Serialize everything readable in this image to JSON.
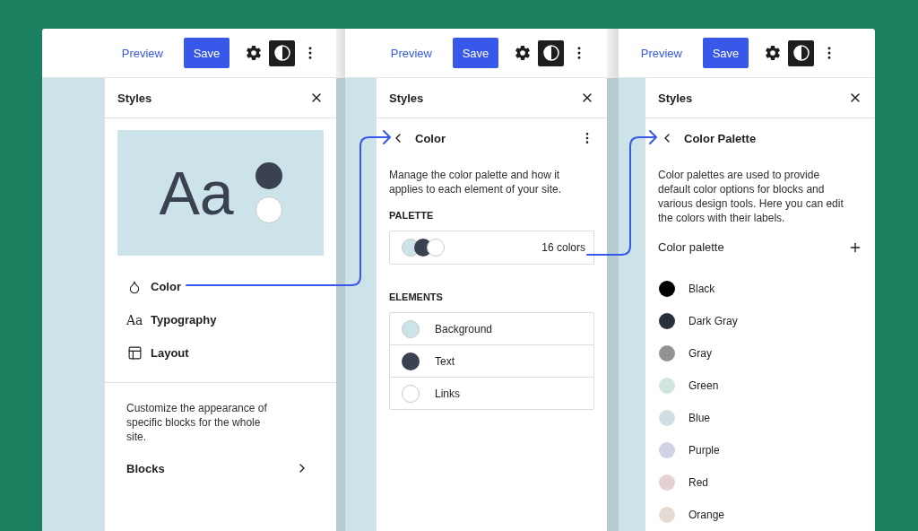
{
  "screens": [
    {
      "kind": "styles",
      "preview_link": "Preview",
      "save_button": "Save",
      "panel_title": "Styles",
      "style_preview": {
        "sample": "Aa",
        "swatches": [
          {
            "color": "#3a4252"
          },
          {
            "color": "#ffffff"
          }
        ]
      },
      "menu": [
        {
          "kind": "droplet",
          "label": "Color"
        },
        {
          "kind": "glyph",
          "glyph": "Aa",
          "label": "Typography"
        },
        {
          "kind": "layout",
          "label": "Layout"
        }
      ],
      "description": "Customize the appearance of specific blocks for the whole site.",
      "blocks_label": "Blocks"
    },
    {
      "kind": "color",
      "preview_link": "Preview",
      "save_button": "Save",
      "panel_title": "Styles",
      "back_title": "Color",
      "description": "Manage the color palette and how it applies to each element of your site.",
      "palette_heading": "PALETTE",
      "palette_swatches": [
        {
          "color": "#cde3ea"
        },
        {
          "color": "#3a4252"
        },
        {
          "color": "#ffffff"
        }
      ],
      "palette_count": "16 colors",
      "elements_heading": "ELEMENTS",
      "elements": [
        {
          "label": "Background",
          "color": "#cde3ea"
        },
        {
          "label": "Text",
          "color": "#3a4252"
        },
        {
          "label": "Links",
          "color": "#ffffff"
        }
      ]
    },
    {
      "kind": "palette",
      "preview_link": "Preview",
      "save_button": "Save",
      "panel_title": "Styles",
      "back_title": "Color Palette",
      "description": "Color palettes are used to provide default color options for blocks and various design tools. Here you can edit the colors with their labels.",
      "palette_label": "Color palette",
      "colors": [
        {
          "name": "Black",
          "color": "#000000"
        },
        {
          "name": "Dark Gray",
          "color": "#28303d"
        },
        {
          "name": "Gray",
          "color": "#939393"
        },
        {
          "name": "Green",
          "color": "#d1e4dd"
        },
        {
          "name": "Blue",
          "color": "#d1dfe4"
        },
        {
          "name": "Purple",
          "color": "#d1d1e4"
        },
        {
          "name": "Red",
          "color": "#e4d1d1"
        },
        {
          "name": "Orange",
          "color": "#e4dad1"
        }
      ]
    }
  ]
}
